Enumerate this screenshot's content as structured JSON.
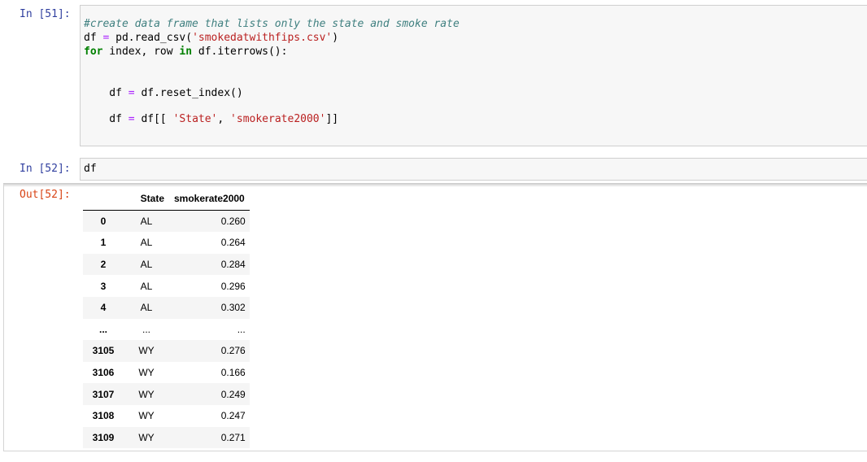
{
  "cell51": {
    "prompt": "In [51]:",
    "comment": "#create data frame that lists only the state and smoke rate",
    "line2_var": "df ",
    "line2_op": "=",
    "line2_call": " pd.read_csv(",
    "line2_str": "'smokedatwithfips.csv'",
    "line2_end": ")",
    "line3_for": "for",
    "line3_mid": " index, row ",
    "line3_in": "in",
    "line3_end": " df.iterrows():",
    "line4_var": "    df ",
    "line4_op": "=",
    "line4_rest": " df.reset_index()",
    "line5_var": "    df ",
    "line5_op": "=",
    "line5_open": " df[[ ",
    "line5_str1": "'State'",
    "line5_comma": ", ",
    "line5_str2": "'smokerate2000'",
    "line5_close": "]]"
  },
  "cell52": {
    "prompt": "In [52]:",
    "code": "df",
    "out_prompt": "Out[52]:"
  },
  "table": {
    "columns": [
      "",
      "State",
      "smokerate2000"
    ],
    "rows": [
      {
        "idx": "0",
        "state": "AL",
        "rate": "0.260"
      },
      {
        "idx": "1",
        "state": "AL",
        "rate": "0.264"
      },
      {
        "idx": "2",
        "state": "AL",
        "rate": "0.284"
      },
      {
        "idx": "3",
        "state": "AL",
        "rate": "0.296"
      },
      {
        "idx": "4",
        "state": "AL",
        "rate": "0.302"
      },
      {
        "idx": "...",
        "state": "...",
        "rate": "..."
      },
      {
        "idx": "3105",
        "state": "WY",
        "rate": "0.276"
      },
      {
        "idx": "3106",
        "state": "WY",
        "rate": "0.166"
      },
      {
        "idx": "3107",
        "state": "WY",
        "rate": "0.249"
      },
      {
        "idx": "3108",
        "state": "WY",
        "rate": "0.247"
      },
      {
        "idx": "3109",
        "state": "WY",
        "rate": "0.271"
      }
    ]
  }
}
